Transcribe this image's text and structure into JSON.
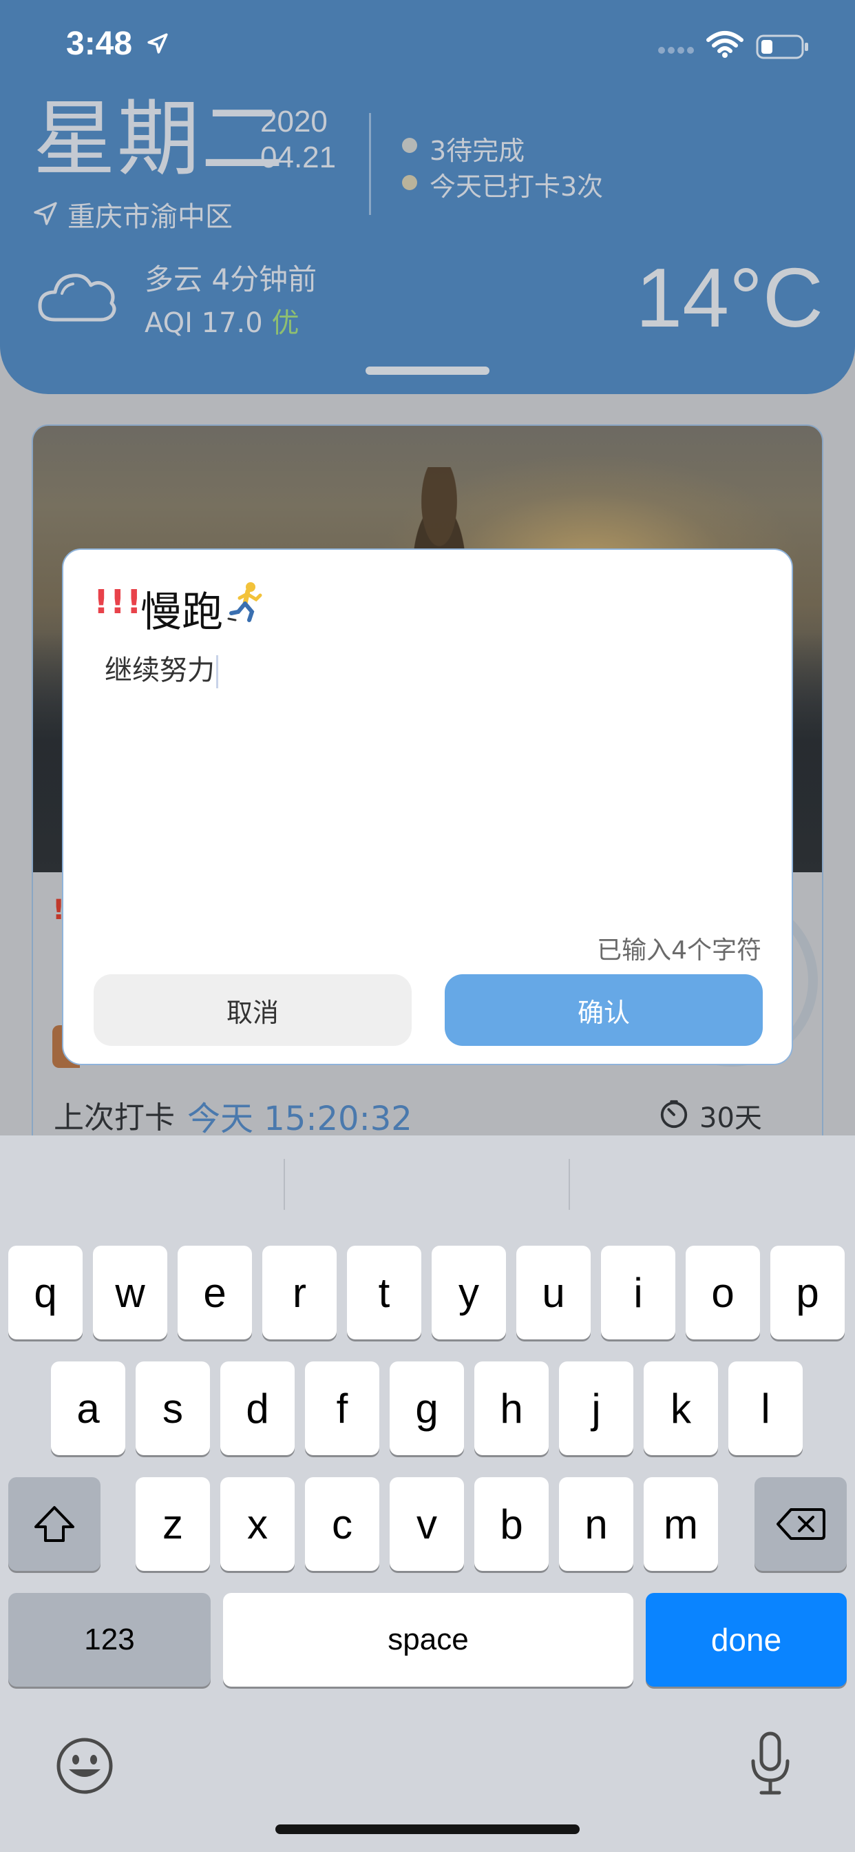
{
  "status_bar": {
    "time": "3:48"
  },
  "header": {
    "weekday": "星期二",
    "year": "2020",
    "date": "04.21",
    "pending": "3待完成",
    "checked_today": "今天已打卡3次",
    "location": "重庆市渝中区",
    "weather": "多云 4分钟前",
    "aqi_prefix": "AQI 17.0 ",
    "aqi_quality": "优",
    "temperature": "14°C"
  },
  "card": {
    "priority_mark": "!",
    "last_checkin_label": "上次打卡",
    "last_checkin_value": "今天 15:20:32",
    "duration": "30天"
  },
  "modal": {
    "priority_mark": "!!!",
    "title": "慢跑",
    "input_text": "继续努力",
    "char_count": "已输入4个字符",
    "cancel_label": "取消",
    "confirm_label": "确认"
  },
  "keyboard": {
    "row1": [
      "q",
      "w",
      "e",
      "r",
      "t",
      "y",
      "u",
      "i",
      "o",
      "p"
    ],
    "row2": [
      "a",
      "s",
      "d",
      "f",
      "g",
      "h",
      "j",
      "k",
      "l"
    ],
    "row3": [
      "z",
      "x",
      "c",
      "v",
      "b",
      "n",
      "m"
    ],
    "numbers_label": "123",
    "space_label": "space",
    "done_label": "done"
  },
  "colors": {
    "header_bg": "#497aab",
    "confirm_bg": "#66a8e6",
    "done_key": "#0a84ff",
    "priority_red": "#e8424a"
  }
}
